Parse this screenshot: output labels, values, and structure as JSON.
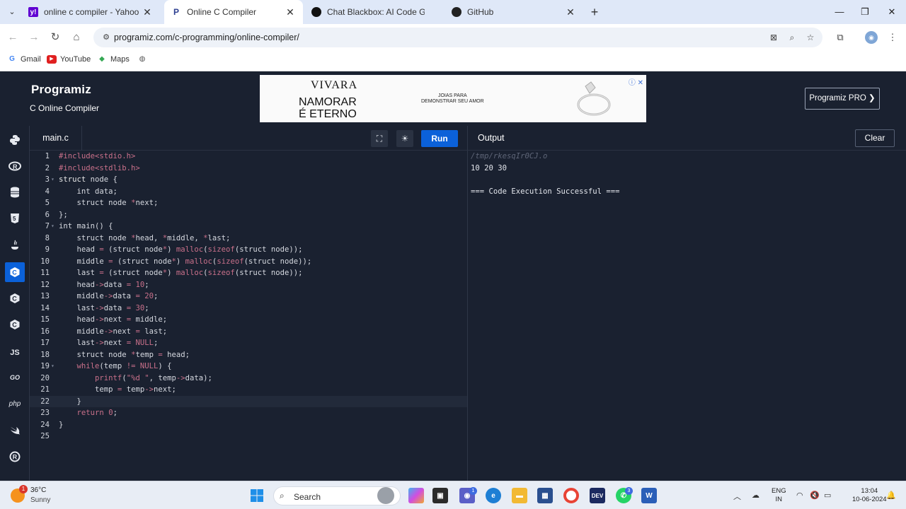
{
  "browser": {
    "tabs": [
      {
        "title": "online c compiler - Yahoo India",
        "favicon": "yahoo-icon"
      },
      {
        "title": "Online C Compiler",
        "favicon": "programiz-icon"
      },
      {
        "title": "Chat Blackbox: AI Code Generat",
        "favicon": "blackbox-icon"
      },
      {
        "title": "GitHub",
        "favicon": "github-icon"
      }
    ],
    "url": "programiz.com/c-programming/online-compiler/",
    "bookmarks": [
      "Gmail",
      "YouTube",
      "Maps"
    ]
  },
  "site": {
    "logo": "Programiz",
    "subtitle": "C Online Compiler",
    "pro_button": "Programiz PRO ❯",
    "ad": {
      "brand": "VIVARA",
      "slogan_line1": "NAMORAR",
      "slogan_line2": "É ETERNO",
      "tagline_line1": "JOIAS PARA",
      "tagline_line2": "DEMONSTRAR SEU AMOR"
    }
  },
  "sidebar": {
    "languages": [
      "python",
      "r",
      "sql",
      "html",
      "java",
      "c",
      "cpp",
      "csharp",
      "js",
      "go",
      "php",
      "swift",
      "rust"
    ],
    "js_label": "JS",
    "go_label": "GO",
    "php_label": "php",
    "active": "c"
  },
  "editor": {
    "file_name": "main.c",
    "run_label": "Run",
    "current_line": 22
  },
  "output": {
    "title": "Output",
    "clear_label": "Clear",
    "lines": [
      "/tmp/rkesqIr0CJ.o",
      "10 20 30",
      "",
      "=== Code Execution Successful ==="
    ]
  },
  "taskbar": {
    "temperature": "36°C",
    "weather": "Sunny",
    "weather_badge": "1",
    "search_placeholder": "Search",
    "teams_badge": "1",
    "whatsapp_badge": "3",
    "lang_line1": "ENG",
    "lang_line2": "IN",
    "time": "13:04",
    "date": "10-06-2024"
  }
}
